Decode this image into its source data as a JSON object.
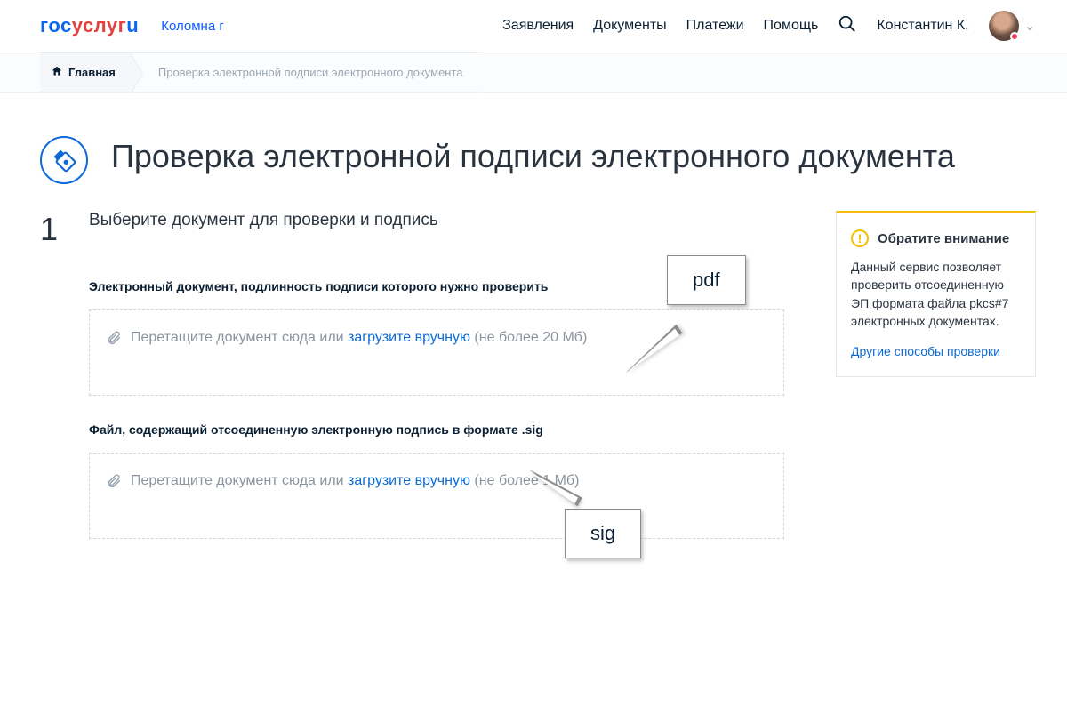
{
  "header": {
    "logo_gos": "гос",
    "logo_uslugi": "услуг",
    "logo_u": "u",
    "city": "Коломна г",
    "nav": {
      "applications": "Заявления",
      "documents": "Документы",
      "payments": "Платежи",
      "help": "Помощь"
    },
    "username": "Константин К."
  },
  "breadcrumb": {
    "home": "Главная",
    "current": "Проверка электронной подписи электронного документа"
  },
  "page": {
    "title": "Проверка электронной подписи электронного документа"
  },
  "step": {
    "number": "1",
    "title": "Выберите документ для проверки и подпись"
  },
  "fields": {
    "doc": {
      "label": "Электронный документ, подлинность подписи которого нужно проверить",
      "drag_text": "Перетащите документ сюда или ",
      "link": "загрузите вручную",
      "hint": " (не более 20 Мб)"
    },
    "sig": {
      "label": "Файл, содержащий отсоединенную электронную подпись в формате .sig",
      "drag_text": "Перетащите документ сюда или ",
      "link": "загрузите вручную",
      "hint": " (не более 1 Мб)"
    }
  },
  "notice": {
    "title": "Обратите внимание",
    "body": "Данный сервис позволяет проверить отсоединенную ЭП формата файла pkcs#7 электронных документах.",
    "link": "Другие способы проверки"
  },
  "annotations": {
    "pdf": "pdf",
    "sig": "sig"
  }
}
